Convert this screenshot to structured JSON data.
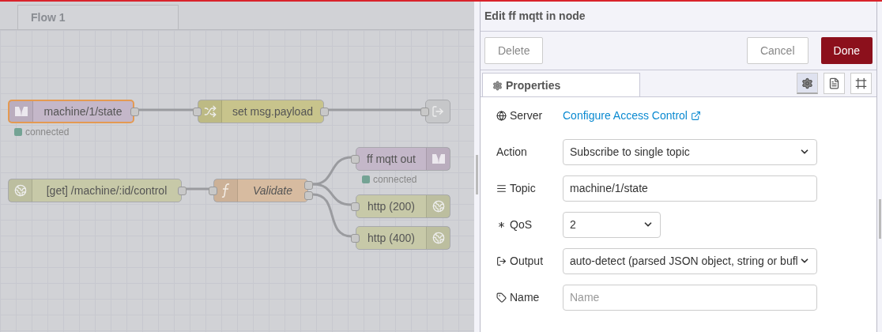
{
  "flow_tabs": [
    {
      "label": "Flow 1",
      "selected": true
    }
  ],
  "nodes": [
    {
      "kind": "mqtt-in",
      "label": "machine/1/state",
      "color": "#c4b7c9",
      "selected": true,
      "status": {
        "text": "connected",
        "color": "#74a394"
      }
    },
    {
      "kind": "change",
      "label": "set msg.payload",
      "color": "#c8c48c",
      "selected": false
    },
    {
      "kind": "link-out",
      "color": "#c6c7c9",
      "selected": false
    },
    {
      "kind": "mqtt-out",
      "label": "ff mqtt out",
      "color": "#c4b7c9",
      "selected": false,
      "status": {
        "text": "connected",
        "color": "#74a394"
      }
    },
    {
      "kind": "http-in",
      "label": "[get] /machine/:id/control",
      "color": "#c7c9a8",
      "selected": false
    },
    {
      "kind": "function",
      "label": "Validate",
      "color": "#d7bba0",
      "selected": false
    },
    {
      "kind": "http-response",
      "label": "http (200)",
      "color": "#c7c9a8",
      "selected": false
    },
    {
      "kind": "http-response",
      "label": "http (400)",
      "color": "#c7c9a8",
      "selected": false
    }
  ],
  "editor": {
    "title": "Edit ff mqtt in node",
    "buttons": [
      {
        "label": "Delete",
        "kind": "plain"
      },
      {
        "label": "Cancel",
        "kind": "plain"
      },
      {
        "label": "Done",
        "kind": "primary"
      }
    ],
    "tabs": [
      {
        "label": "Properties",
        "selected": true
      }
    ],
    "view_buttons": [
      {
        "kind": "gear",
        "selected": true
      },
      {
        "kind": "document",
        "selected": false
      },
      {
        "kind": "frame",
        "selected": false
      }
    ],
    "fields": [
      {
        "kind": "link",
        "label": "Server",
        "value": "Configure Access Control"
      },
      {
        "kind": "select",
        "label": "Action",
        "value": "Subscribe to single topic"
      },
      {
        "kind": "input",
        "label": "Topic",
        "value": "machine/1/state"
      },
      {
        "kind": "select-small",
        "label": "QoS",
        "value": "2"
      },
      {
        "kind": "select",
        "label": "Output",
        "value": "auto-detect (parsed JSON object, string or bufl"
      },
      {
        "kind": "input",
        "label": "Name",
        "placeholder": "Name"
      }
    ]
  }
}
